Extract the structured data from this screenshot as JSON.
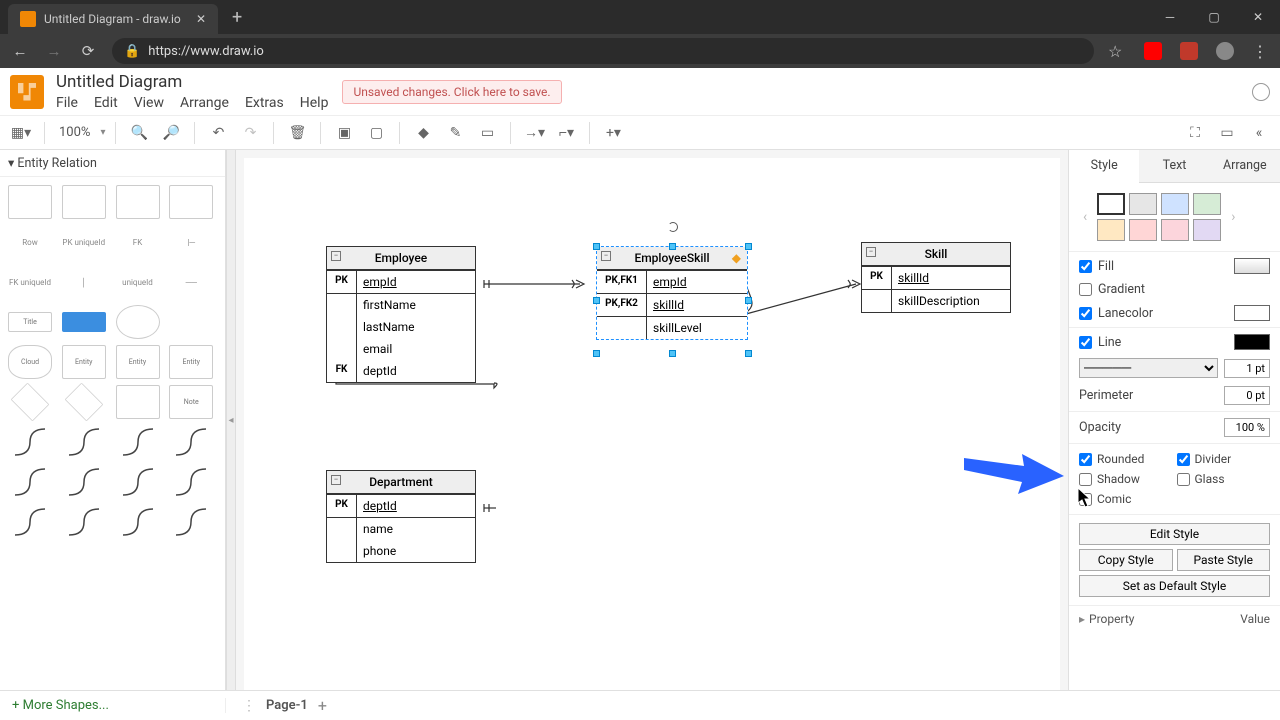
{
  "browser": {
    "tab_title": "Untitled Diagram - draw.io",
    "url": "https://www.draw.io"
  },
  "app": {
    "doc_title": "Untitled Diagram",
    "menus": [
      "File",
      "Edit",
      "View",
      "Arrange",
      "Extras",
      "Help"
    ],
    "unsaved_msg": "Unsaved changes. Click here to save."
  },
  "toolbar": {
    "zoom": "100%"
  },
  "sidebar": {
    "category": "Entity Relation",
    "more_shapes": "More Shapes..."
  },
  "canvas": {
    "entities": {
      "employee": {
        "title": "Employee",
        "rows": [
          {
            "key": "PK",
            "field": "empId",
            "u": true
          },
          {
            "key": "",
            "field": "firstName"
          },
          {
            "key": "",
            "field": "lastName"
          },
          {
            "key": "",
            "field": "email"
          },
          {
            "key": "FK",
            "field": "deptId"
          }
        ]
      },
      "employeeSkill": {
        "title": "EmployeeSkill",
        "rows": [
          {
            "key": "PK,FK1",
            "field": "empId",
            "u": true
          },
          {
            "key": "PK,FK2",
            "field": "skillId",
            "u": true
          },
          {
            "key": "",
            "field": "skillLevel"
          }
        ]
      },
      "skill": {
        "title": "Skill",
        "rows": [
          {
            "key": "PK",
            "field": "skillId",
            "u": true
          },
          {
            "key": "",
            "field": "skillDescription"
          }
        ]
      },
      "department": {
        "title": "Department",
        "rows": [
          {
            "key": "PK",
            "field": "deptId",
            "u": true
          },
          {
            "key": "",
            "field": "name"
          },
          {
            "key": "",
            "field": "phone"
          }
        ]
      }
    }
  },
  "style_panel": {
    "tabs": [
      "Style",
      "Text",
      "Arrange"
    ],
    "swatch_colors": [
      "#ffffff",
      "#e6e6e6",
      "#cfe2ff",
      "#d6ecd6",
      "#ffe8c2",
      "#ffd6d6",
      "#fcd5dc",
      "#e2d9f3"
    ],
    "fill_label": "Fill",
    "gradient_label": "Gradient",
    "lanecolor_label": "Lanecolor",
    "line_label": "Line",
    "line_width": "1 pt",
    "perimeter_label": "Perimeter",
    "perimeter_val": "0 pt",
    "opacity_label": "Opacity",
    "opacity_val": "100 %",
    "checks": {
      "rounded": "Rounded",
      "divider": "Divider",
      "shadow": "Shadow",
      "glass": "Glass",
      "comic": "Comic"
    },
    "btn_edit_style": "Edit Style",
    "btn_copy_style": "Copy Style",
    "btn_paste_style": "Paste Style",
    "btn_default_style": "Set as Default Style",
    "property_label": "Property",
    "value_label": "Value"
  },
  "footer": {
    "page": "Page-1"
  }
}
